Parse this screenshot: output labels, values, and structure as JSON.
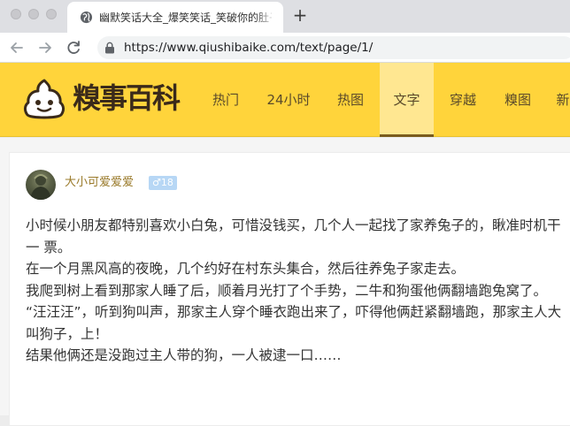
{
  "browser": {
    "tab_title": "幽默笑话大全_爆笑笑话_笑破你的肚子",
    "new_tab_label": "+",
    "url": "https://www.qiushibaike.com/text/page/1/"
  },
  "site": {
    "logo_text": "糗事百科",
    "nav": [
      {
        "label": "热门"
      },
      {
        "label": "24小时"
      },
      {
        "label": "热图"
      },
      {
        "label": "文字"
      },
      {
        "label": "穿越"
      },
      {
        "label": "糗图"
      },
      {
        "label": "新"
      }
    ],
    "active_nav": "文字",
    "colors": {
      "header": "#ffd43b",
      "active_tab": "#ffe791",
      "username": "#9a7a2a",
      "badge": "#b7d7f5"
    }
  },
  "post": {
    "username": "大小可爱爱爱",
    "gender_icon": "♂",
    "age": "18",
    "paragraphs": [
      "小时候小朋友都特别喜欢小白兔，可惜没钱买，几个人一起找了家养兔子的，瞅准时机干一 票。",
      "在一个月黑风高的夜晚，几个约好在村东头集合，然后往养兔子家走去。",
      "我爬到树上看到那家人睡了后，顺着月光打了个手势，二牛和狗蛋他俩翻墙跑兔窝了。",
      "“汪汪汪”，听到狗叫声，那家主人穿个睡衣跑出来了，吓得他俩赶紧翻墙跑，那家主人大叫狗子，上！",
      "结果他俩还是没跑过主人带的狗，一人被逮一口……"
    ]
  }
}
